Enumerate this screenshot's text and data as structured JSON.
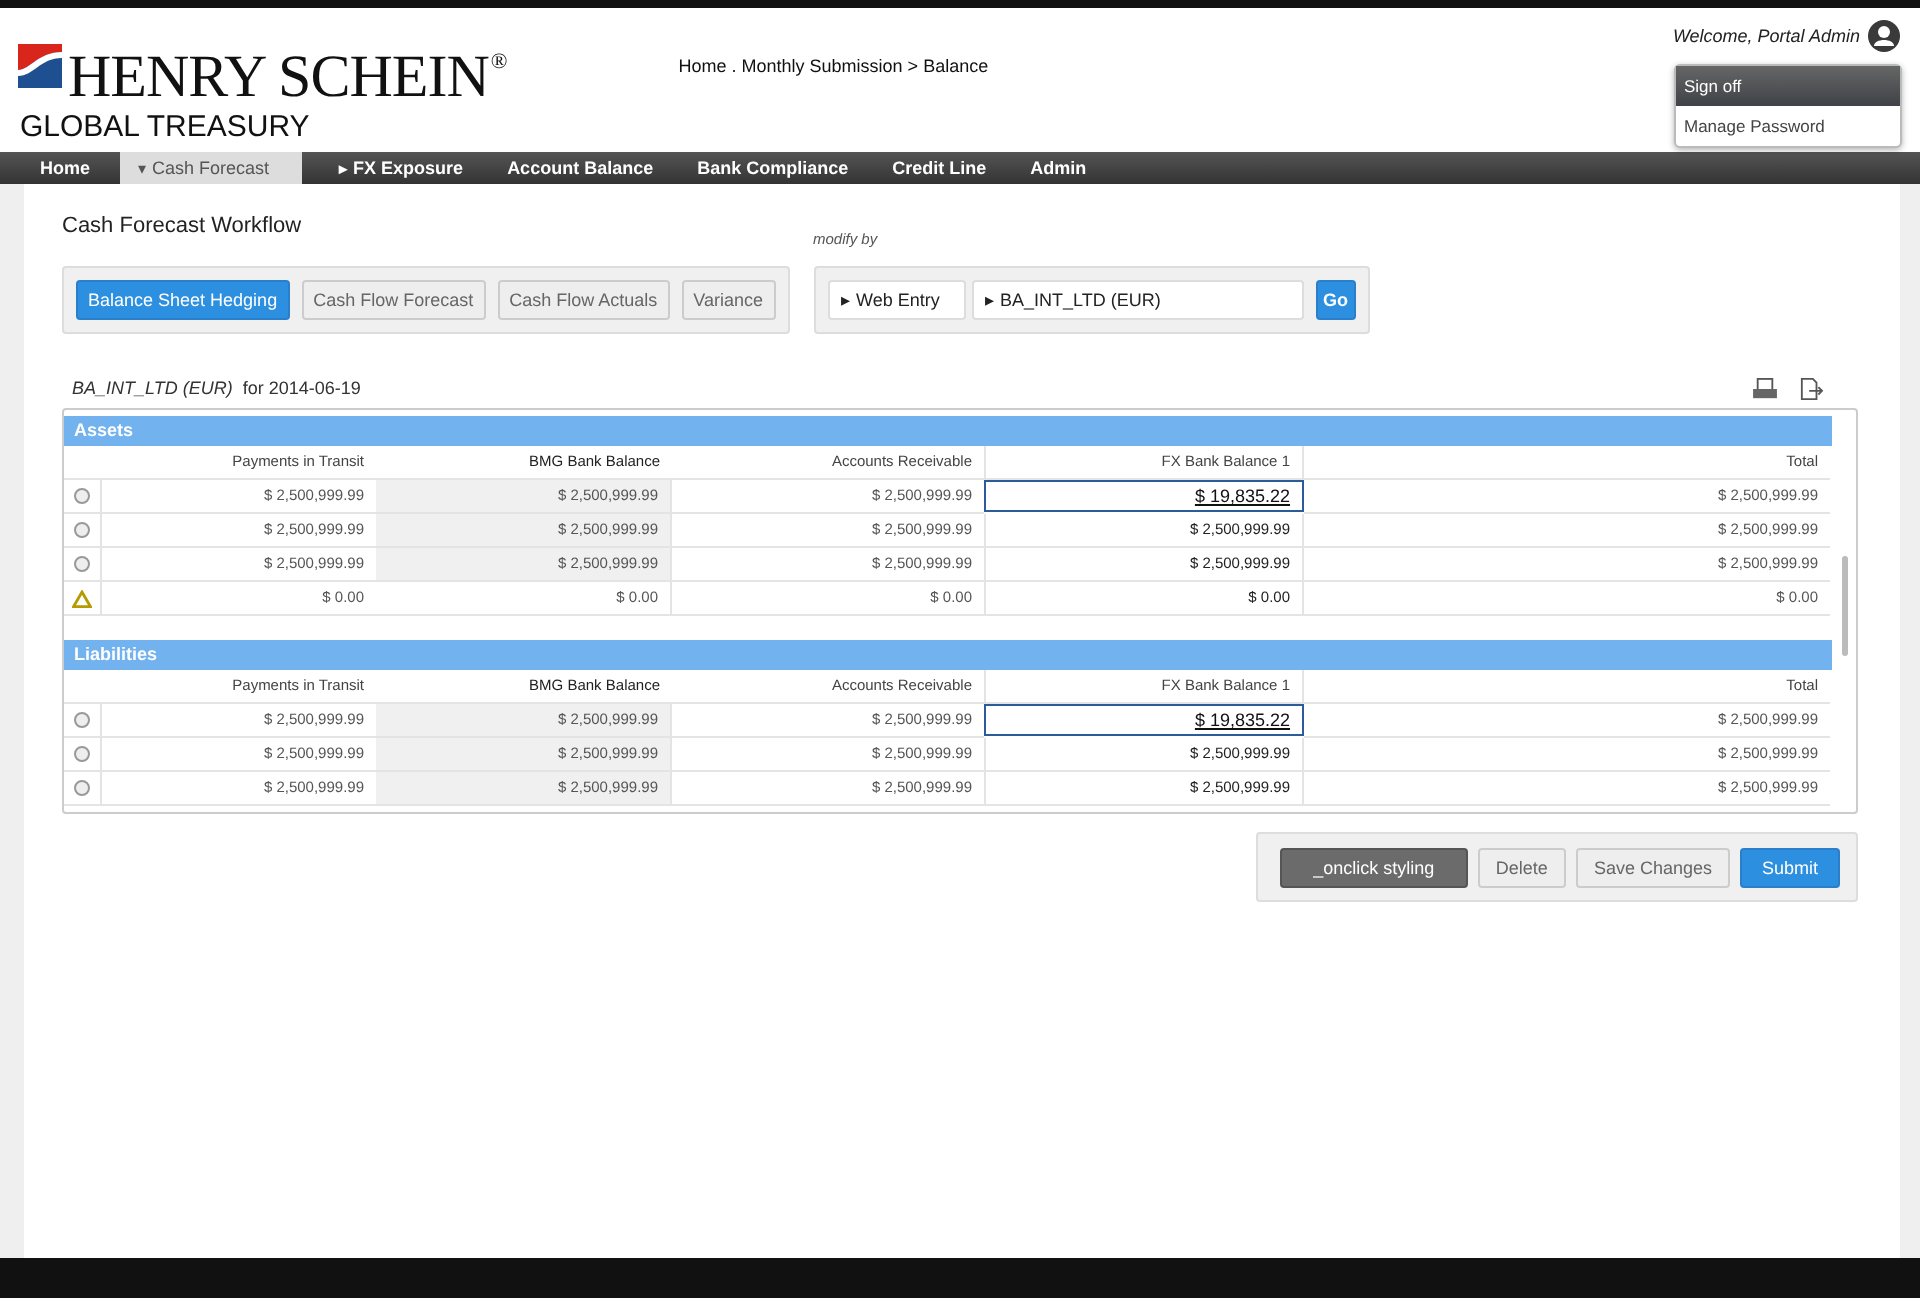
{
  "header": {
    "brand": "HENRY SCHEIN",
    "brand_mark": "®",
    "brand_sub": "GLOBAL TREASURY",
    "breadcrumb": "Home . Monthly Submission >  Balance",
    "welcome": "Welcome, Portal Admin"
  },
  "user_menu": [
    {
      "label": "Sign off",
      "selected": true
    },
    {
      "label": "Manage Password",
      "selected": false
    }
  ],
  "nav": [
    {
      "label": "Home",
      "selected": false
    },
    {
      "label": "Cash Forecast",
      "selected": true,
      "caret": "▾"
    },
    {
      "label": "FX Exposure",
      "selected": false,
      "caret": "▸"
    },
    {
      "label": "Account Balance",
      "selected": false
    },
    {
      "label": "Bank Compliance",
      "selected": false
    },
    {
      "label": "Credit Line",
      "selected": false
    },
    {
      "label": "Admin",
      "selected": false
    }
  ],
  "workflow": {
    "title": "Cash Forecast Workflow",
    "steps": [
      {
        "label": "Balance Sheet Hedging",
        "selected": true
      },
      {
        "label": "Cash Flow Forecast",
        "selected": false
      },
      {
        "label": "Cash Flow Actuals",
        "selected": false
      },
      {
        "label": "Variance",
        "selected": false
      }
    ]
  },
  "modify": {
    "label": "modify by",
    "source_caret": "▸",
    "source": "Web Entry",
    "entity_caret": "▸",
    "entity": "BA_INT_LTD (EUR)",
    "button": "Go"
  },
  "subtitle": "*BA_INT_LTD (EUR)*  for 2014-06-19",
  "sections": [
    {
      "title": "Assets",
      "columns": [
        "Payments in Transit",
        "BMG Bank Balance",
        "Accounts Receivable",
        "FX Bank Balance 1",
        "Total"
      ],
      "rows": [
        {
          "kind": "radio",
          "selected": false,
          "editing": true,
          "cells": [
            "$ 2,500,999.99",
            "$ 2,500,999.99",
            "$ 2,500,999.99",
            "$ 19,835.22",
            "$ 2,500,999.99"
          ]
        },
        {
          "kind": "radio",
          "selected": false,
          "editing": false,
          "cells": [
            "$ 2,500,999.99",
            "$ 2,500,999.99",
            "$ 2,500,999.99",
            "$ 2,500,999.99",
            "$ 2,500,999.99"
          ]
        },
        {
          "kind": "radio",
          "selected": false,
          "editing": false,
          "cells": [
            "$ 2,500,999.99",
            "$ 2,500,999.99",
            "$ 2,500,999.99",
            "$ 2,500,999.99",
            "$ 2,500,999.99"
          ]
        },
        {
          "kind": "warning",
          "selected": false,
          "editing": false,
          "cells": [
            "$ 0.00",
            "$ 0.00",
            "$ 0.00",
            "$ 0.00",
            "$ 0.00"
          ]
        }
      ]
    },
    {
      "title": "Liabilities",
      "columns": [
        "Payments in Transit",
        "BMG Bank Balance",
        "Accounts Receivable",
        "FX Bank Balance 1",
        "Total"
      ],
      "rows": [
        {
          "kind": "radio",
          "selected": false,
          "editing": true,
          "cells": [
            "$ 2,500,999.99",
            "$ 2,500,999.99",
            "$ 2,500,999.99",
            "$ 19,835.22",
            "$ 2,500,999.99"
          ]
        },
        {
          "kind": "radio",
          "selected": false,
          "editing": false,
          "cells": [
            "$ 2,500,999.99",
            "$ 2,500,999.99",
            "$ 2,500,999.99",
            "$ 2,500,999.99",
            "$ 2,500,999.99"
          ]
        },
        {
          "kind": "radio",
          "selected": false,
          "editing": false,
          "cells": [
            "$ 2,500,999.99",
            "$ 2,500,999.99",
            "$ 2,500,999.99",
            "$ 2,500,999.99",
            "$ 2,500,999.99"
          ]
        }
      ]
    }
  ],
  "actions": [
    {
      "label": "_onclick styling",
      "kind": "dark"
    },
    {
      "label": "Delete",
      "kind": "plain"
    },
    {
      "label": "Save Changes",
      "kind": "plain"
    },
    {
      "label": "Submit",
      "kind": "primary"
    }
  ]
}
